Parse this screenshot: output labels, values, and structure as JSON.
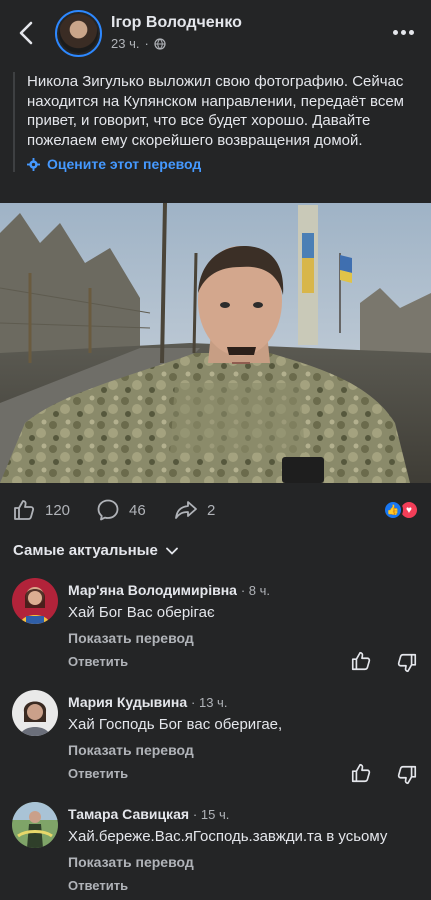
{
  "header": {
    "author": "Ігор Володченко",
    "time": "23 ч."
  },
  "post": {
    "text": "Никола Зигулько выложил свою фотографию. Сейчас находится на Купянском направлении, передаёт всем привет, и говорит, что все будет хорошо. Давайте пожелаем ему скорейшего возвращения домой.",
    "translate_label": "Оцените этот перевод"
  },
  "actions": {
    "likes": "120",
    "comments": "46",
    "shares": "2"
  },
  "sort_label": "Самые актуальные",
  "comments": [
    {
      "name": "Мар'яна Володимирівна",
      "time": "8 ч.",
      "text": "Хай Бог Вас оберігає",
      "translate": "Показать перевод",
      "reply": "Ответить"
    },
    {
      "name": "Мария Кудывина",
      "time": "13 ч.",
      "text": "Хай Господь Бог вас оберигае,",
      "translate": "Показать перевод",
      "reply": "Ответить"
    },
    {
      "name": "Тамара Савицкая",
      "time": "15 ч.",
      "text": "Хай.береже.Вас.яГосподь.завжди.та в усьому",
      "translate": "Показать перевод",
      "reply": "Ответить"
    }
  ],
  "colors": {
    "background": "#242526",
    "link": "#4599ff",
    "like": "#1877f2",
    "love": "#f33e58"
  }
}
